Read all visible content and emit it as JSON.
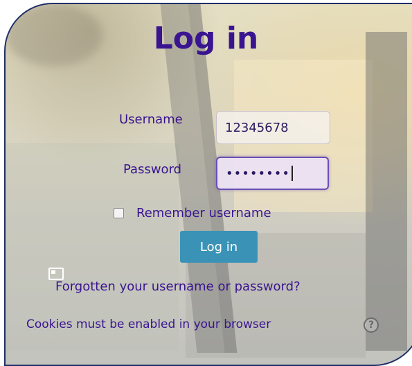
{
  "page": {
    "title": "Log in"
  },
  "form": {
    "username_label": "Username",
    "username_value": "12345678",
    "password_label": "Password",
    "password_masked": "••••••••",
    "remember_label": "Remember username",
    "remember_checked": false,
    "submit_label": "Log in"
  },
  "links": {
    "forgot": "Forgotten your username or password?",
    "cookies": "Cookies must be enabled in your browser"
  },
  "icons": {
    "help": "question-circle-icon",
    "help_glyph": "?",
    "page": "window-icon"
  },
  "colors": {
    "title": "#3a1490",
    "text": "#3a1490",
    "button": "#3a93b7",
    "border": "#1f2f66",
    "focus": "#6a4fb3"
  }
}
